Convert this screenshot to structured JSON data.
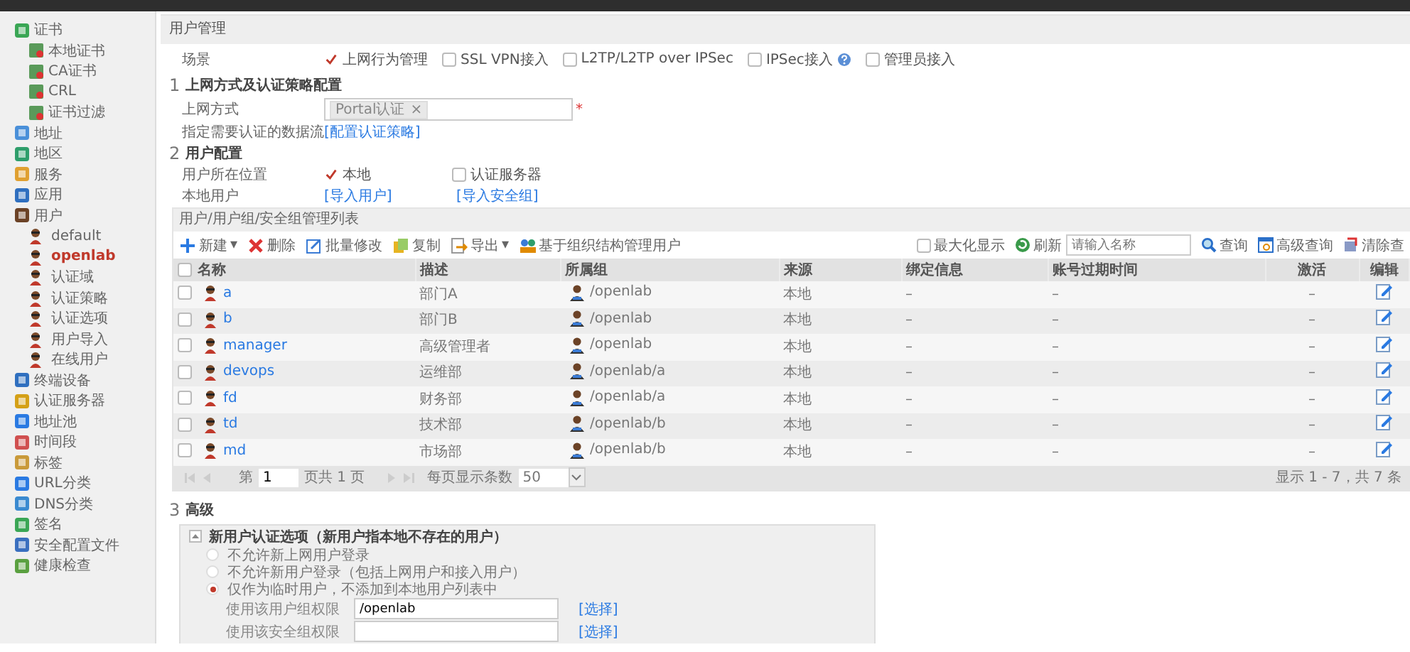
{
  "sidebar": {
    "items": [
      {
        "label": "证书",
        "selected": false,
        "children": [
          {
            "label": "本地证书",
            "selected": false
          },
          {
            "label": "CA证书",
            "selected": false
          },
          {
            "label": "CRL",
            "selected": false
          },
          {
            "label": "证书过滤",
            "selected": false
          }
        ]
      },
      {
        "label": "地址",
        "selected": false
      },
      {
        "label": "地区",
        "selected": false
      },
      {
        "label": "服务",
        "selected": false
      },
      {
        "label": "应用",
        "selected": false
      },
      {
        "label": "用户",
        "selected": false,
        "children": [
          {
            "label": "default",
            "selected": false
          },
          {
            "label": "openlab",
            "selected": true
          },
          {
            "label": "认证域",
            "selected": false
          },
          {
            "label": "认证策略",
            "selected": false
          },
          {
            "label": "认证选项",
            "selected": false
          },
          {
            "label": "用户导入",
            "selected": false
          },
          {
            "label": "在线用户",
            "selected": false
          }
        ]
      },
      {
        "label": "终端设备",
        "selected": false
      },
      {
        "label": "认证服务器",
        "selected": false
      },
      {
        "label": "地址池",
        "selected": false
      },
      {
        "label": "时间段",
        "selected": false
      },
      {
        "label": "标签",
        "selected": false
      },
      {
        "label": "URL分类",
        "selected": false
      },
      {
        "label": "DNS分类",
        "selected": false
      },
      {
        "label": "签名",
        "selected": false
      },
      {
        "label": "安全配置文件",
        "selected": false
      },
      {
        "label": "健康检查",
        "selected": false
      }
    ]
  },
  "config": {
    "title": "用户管理",
    "scene_label": "场景",
    "scenes": [
      {
        "label": "上网行为管理",
        "checked": true,
        "help": false
      },
      {
        "label": "SSL VPN接入",
        "checked": false,
        "help": false
      },
      {
        "label": "L2TP/L2TP over IPSec",
        "checked": false,
        "help": false
      },
      {
        "label": "IPSec接入",
        "checked": false,
        "help": true
      },
      {
        "label": "管理员接入",
        "checked": false,
        "help": false
      }
    ],
    "section1": {
      "number": "1",
      "title": "上网方式及认证策略配置",
      "access_label": "上网方式",
      "access_tag": "Portal认证",
      "tag_remove": "×",
      "required": "*",
      "flow_label": "指定需要认证的数据流",
      "flow_link": "[配置认证策略]"
    },
    "section2": {
      "number": "2",
      "title": "用户配置",
      "location_label": "用户所在位置",
      "locations": [
        {
          "label": "本地",
          "checked": true
        },
        {
          "label": "认证服务器",
          "checked": false
        }
      ],
      "local_label": "本地用户",
      "links": [
        "[导入用户]",
        "[导入安全组]"
      ]
    }
  },
  "table_panel": {
    "title": "用户/用户组/安全组管理列表",
    "toolbar": [
      {
        "label": "新建",
        "dropdown": "▾",
        "kind": "add"
      },
      {
        "label": "删除",
        "kind": "delete"
      },
      {
        "label": "批量修改",
        "kind": "batch"
      },
      {
        "label": "复制",
        "kind": "copy"
      },
      {
        "label": "导出",
        "dropdown": "▾",
        "kind": "export"
      },
      {
        "label": "基于组织结构管理用户",
        "kind": "org"
      }
    ],
    "select_all": {
      "checked": false
    },
    "maximize": {
      "label": "最大化显示",
      "checked": false
    },
    "refresh": "刷新",
    "search": {
      "placeholder": "请输入名称"
    },
    "query": "查询",
    "advanced_query": "高级查询",
    "clear_query": "清除查",
    "columns": [
      "名称",
      "描述",
      "所属组",
      "来源",
      "绑定信息",
      "账号过期时间",
      "激活",
      "编辑"
    ],
    "rows": [
      {
        "name": "a",
        "description": "部门A",
        "group": "/openlab",
        "source": "本地",
        "binding": "–",
        "expiry": "–",
        "active": "–",
        "selected": false
      },
      {
        "name": "b",
        "description": "部门B",
        "group": "/openlab",
        "source": "本地",
        "binding": "–",
        "expiry": "–",
        "active": "–",
        "selected": false
      },
      {
        "name": "manager",
        "description": "高级管理者",
        "group": "/openlab",
        "source": "本地",
        "binding": "–",
        "expiry": "–",
        "active": "–",
        "selected": false
      },
      {
        "name": "devops",
        "description": "运维部",
        "group": "/openlab/a",
        "source": "本地",
        "binding": "–",
        "expiry": "–",
        "active": "–",
        "selected": false
      },
      {
        "name": "fd",
        "description": "财务部",
        "group": "/openlab/a",
        "source": "本地",
        "binding": "–",
        "expiry": "–",
        "active": "–",
        "selected": false
      },
      {
        "name": "td",
        "description": "技术部",
        "group": "/openlab/b",
        "source": "本地",
        "binding": "–",
        "expiry": "–",
        "active": "–",
        "selected": false
      },
      {
        "name": "md",
        "description": "市场部",
        "group": "/openlab/b",
        "source": "本地",
        "binding": "–",
        "expiry": "–",
        "active": "–",
        "selected": false
      }
    ],
    "pager": {
      "page_prefix": "第",
      "page": "1",
      "page_suffix": "页共 1 页",
      "per_page_label": "每页显示条数",
      "per_page": "50",
      "summary": "显示 1 - 7，共 7 条"
    }
  },
  "advanced": {
    "number": "3",
    "title": "高级",
    "group_title": "新用户认证选项（新用户指本地不存在的用户）",
    "options": [
      {
        "label": "不允许新上网用户登录",
        "selected": false
      },
      {
        "label": "不允许新用户登录（包括上网用户和接入用户）",
        "selected": false
      },
      {
        "label": "仅作为临时用户，不添加到本地用户列表中",
        "selected": true
      }
    ],
    "fields": [
      {
        "label": "使用该用户组权限",
        "value": "/openlab",
        "link": "[选择]"
      },
      {
        "label": "使用该安全组权限",
        "link": "[选择]"
      }
    ]
  }
}
